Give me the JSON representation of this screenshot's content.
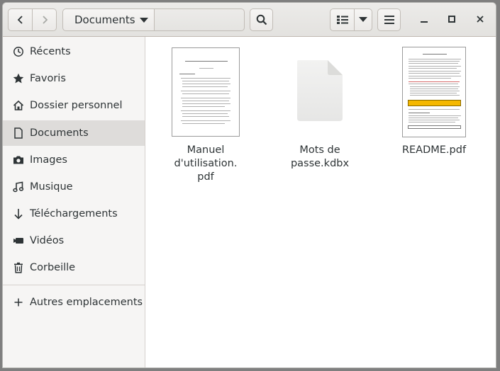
{
  "window": {
    "title": "Documents",
    "path_label": "Documents"
  },
  "toolbar": {
    "back_icon": "chevron-left",
    "forward_icon": "chevron-right",
    "search_icon": "search",
    "view_icon": "list-view",
    "view_menu_icon": "caret-down",
    "menu_icon": "hamburger"
  },
  "sidebar": {
    "items": [
      {
        "label": "Récents",
        "icon": "clock"
      },
      {
        "label": "Favoris",
        "icon": "star"
      },
      {
        "label": "Dossier personnel",
        "icon": "home"
      },
      {
        "label": "Documents",
        "icon": "document",
        "active": true
      },
      {
        "label": "Images",
        "icon": "camera"
      },
      {
        "label": "Musique",
        "icon": "music-note"
      },
      {
        "label": "Téléchargements",
        "icon": "download-arrow"
      },
      {
        "label": "Vidéos",
        "icon": "video-camera"
      },
      {
        "label": "Corbeille",
        "icon": "trash"
      }
    ],
    "other_locations": {
      "label": "Autres emplacements",
      "icon": "plus"
    }
  },
  "files": [
    {
      "name_line1": "Manuel d'utilisation.",
      "name_line2": "pdf",
      "type": "pdf"
    },
    {
      "name_line1": "Mots de passe.kdbx",
      "name_line2": "",
      "type": "generic"
    },
    {
      "name_line1": "README.pdf",
      "name_line2": "",
      "type": "pdf"
    }
  ],
  "colors": {
    "sidebar_bg": "#f6f5f4",
    "sidebar_active": "#dedcda",
    "readme_highlight": "#f5b800"
  }
}
